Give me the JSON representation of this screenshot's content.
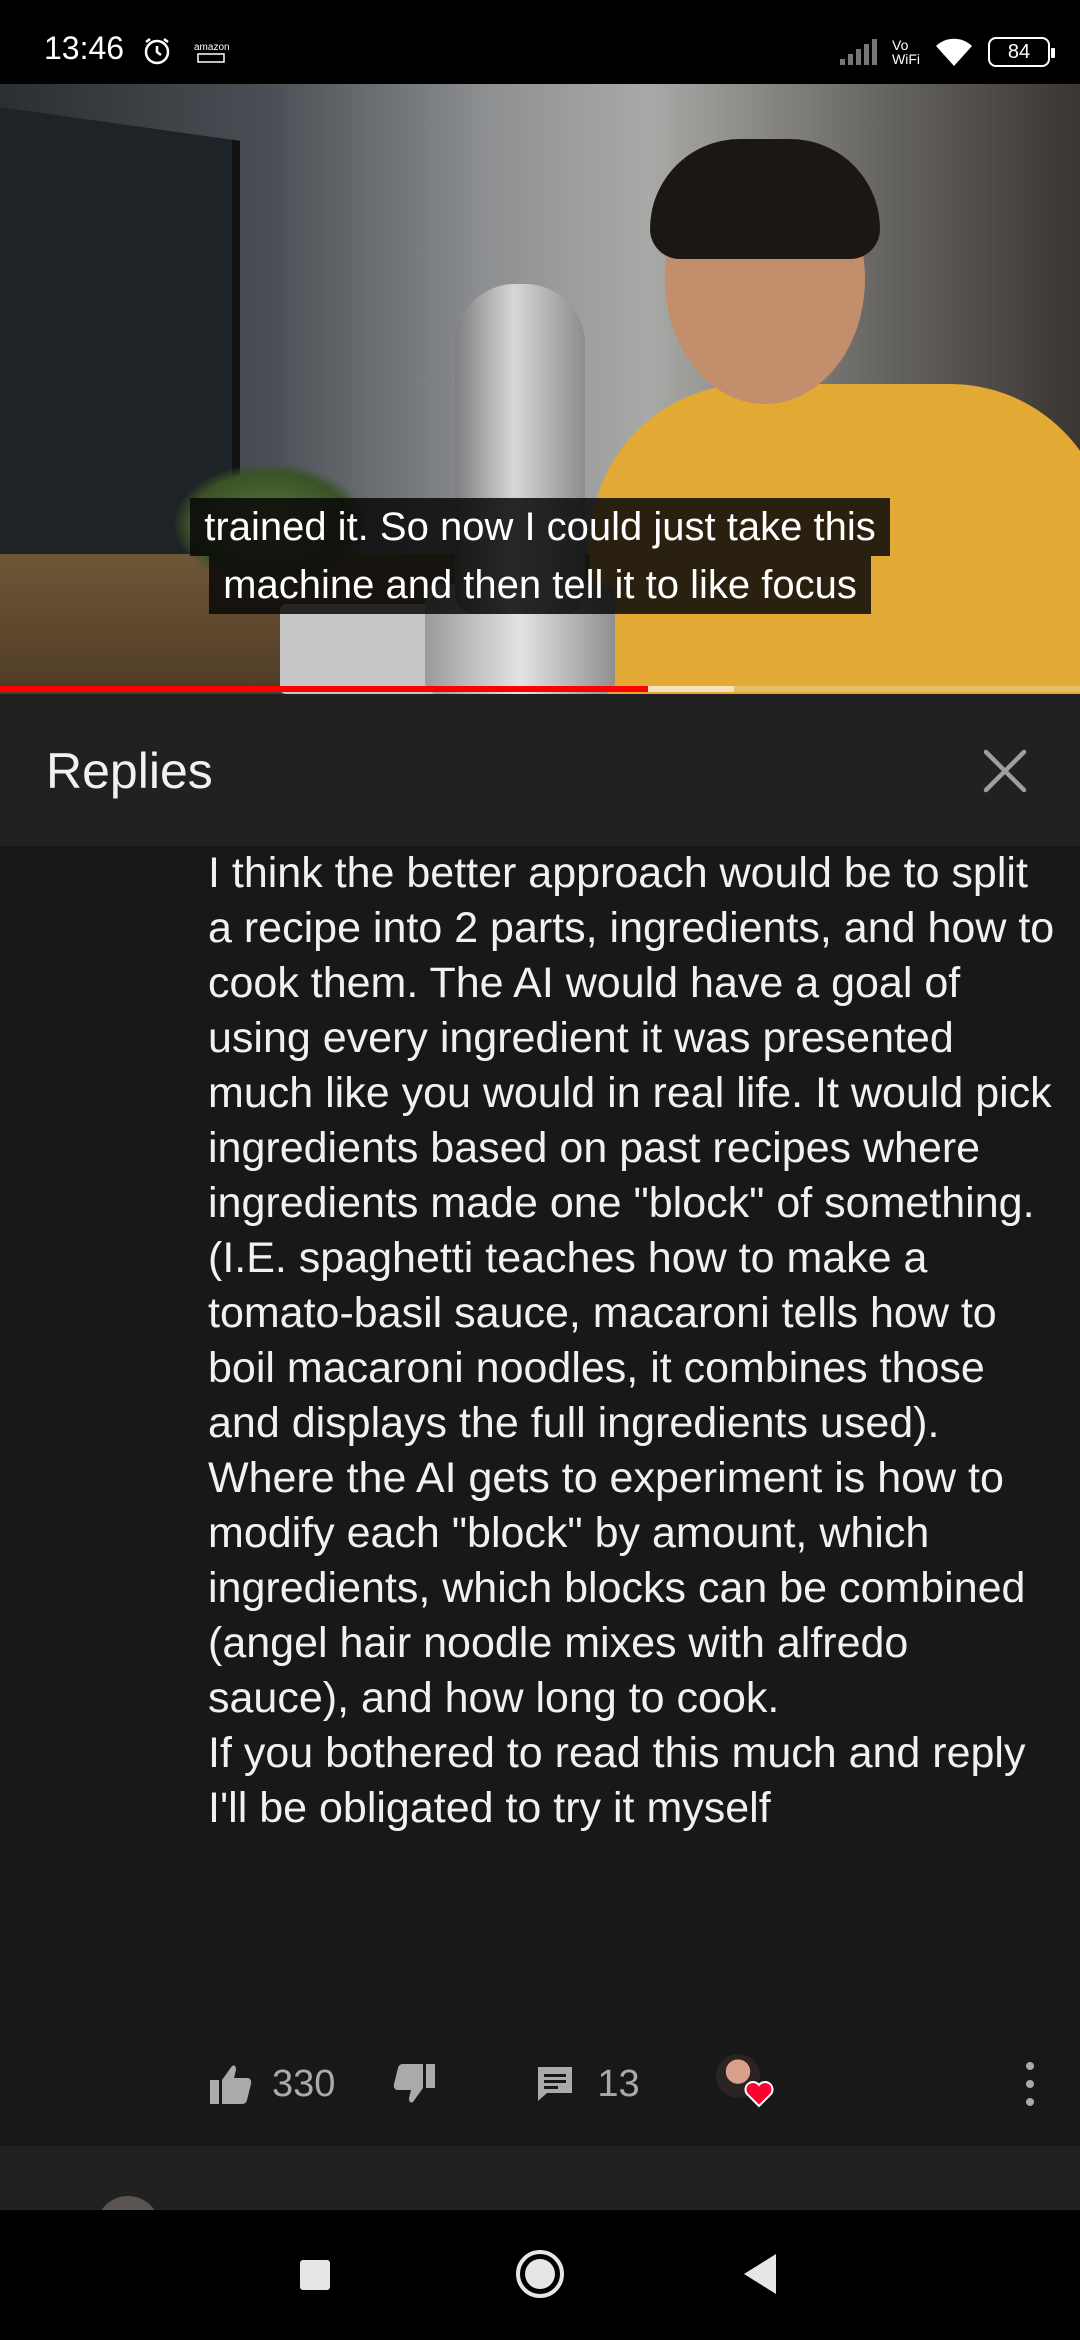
{
  "status_bar": {
    "time": "13:46",
    "vowifi_top": "Vo",
    "vowifi_bottom": "WiFi",
    "battery": "84",
    "amazon_label": "amazon"
  },
  "video": {
    "caption_line1": "trained it. So now I could just take this",
    "caption_line2": "machine and then tell it to like focus",
    "progress_played": 0.6,
    "progress_buffered": 0.68,
    "colors": {
      "progress_played": "#ff0000"
    }
  },
  "replies": {
    "title": "Replies",
    "close_icon": "close-icon",
    "comment": {
      "paragraph1": "I think the better approach would be to split a recipe into 2 parts, ingredients, and how to cook them. The AI would have a goal of using every ingredient it was presented much like you would in real life. It would pick ingredients based on past recipes where ingredients made one \"block\" of something. (I.E. spaghetti teaches how to make a tomato-basil sauce, macaroni tells how to boil macaroni noodles, it combines those and displays the full ingredients used).",
      "paragraph2": "Where the AI gets to experiment is how to modify each \"block\" by amount, which ingredients, which blocks can be combined (angel hair noodle mixes with alfredo sauce), and how long to cook.",
      "paragraph3": "If you bothered to read this much and reply I'll be obligated to try it myself"
    },
    "actions": {
      "like_count": "330",
      "reply_count": "13"
    }
  }
}
